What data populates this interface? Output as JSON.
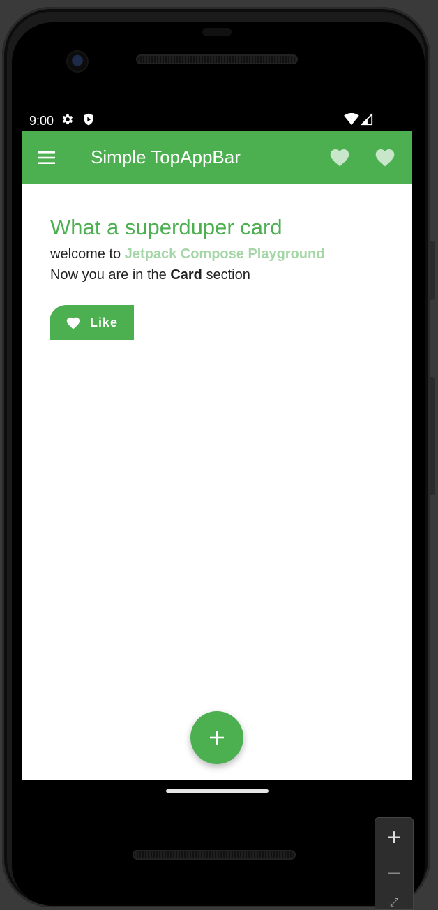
{
  "status_bar": {
    "time": "9:00",
    "icons": [
      "gear-icon",
      "shield-icon",
      "wifi-icon",
      "signal-icon"
    ]
  },
  "top_app_bar": {
    "menu_icon": "menu-icon",
    "title": "Simple TopAppBar",
    "actions": [
      {
        "icon": "heart-icon"
      },
      {
        "icon": "heart-icon"
      }
    ],
    "color": "#4caf50"
  },
  "card": {
    "title": "What a superduper card",
    "line1_prefix": "welcome to ",
    "line1_highlight": "Jetpack Compose Playground",
    "line2_prefix": "Now you are in the ",
    "line2_bold": "Card",
    "line2_suffix": " section",
    "like_button": {
      "icon": "heart-icon",
      "label": "Like"
    }
  },
  "fab": {
    "icon": "plus-icon"
  },
  "emulator_zoom": {
    "plus": "+",
    "minus": "−",
    "fit": "⤢"
  },
  "colors": {
    "accent": "#4caf50",
    "accent_light": "#a5d6a7",
    "heart_fill": "#c8e6c9"
  }
}
